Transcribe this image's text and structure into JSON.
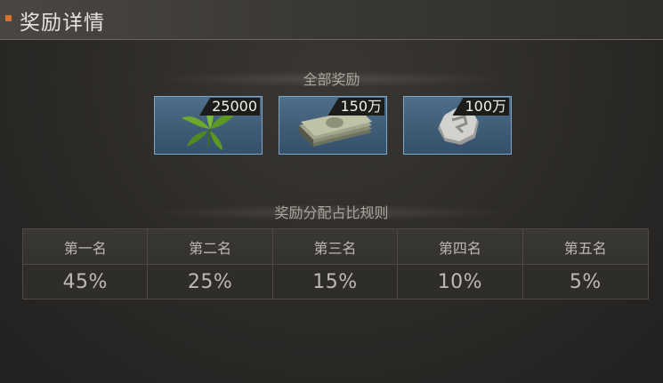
{
  "header": {
    "title": "奖励详情"
  },
  "rewards": {
    "title": "全部奖励",
    "items": [
      {
        "icon": "herb-leaves-icon",
        "count": "25000"
      },
      {
        "icon": "cash-stack-icon",
        "count": "150万"
      },
      {
        "icon": "silver-coin-icon",
        "count": "100万"
      }
    ]
  },
  "distribution": {
    "title": "奖励分配占比规则",
    "ranks": [
      "第一名",
      "第二名",
      "第三名",
      "第四名",
      "第五名"
    ],
    "percents": [
      "45%",
      "25%",
      "15%",
      "10%",
      "5%"
    ]
  }
}
